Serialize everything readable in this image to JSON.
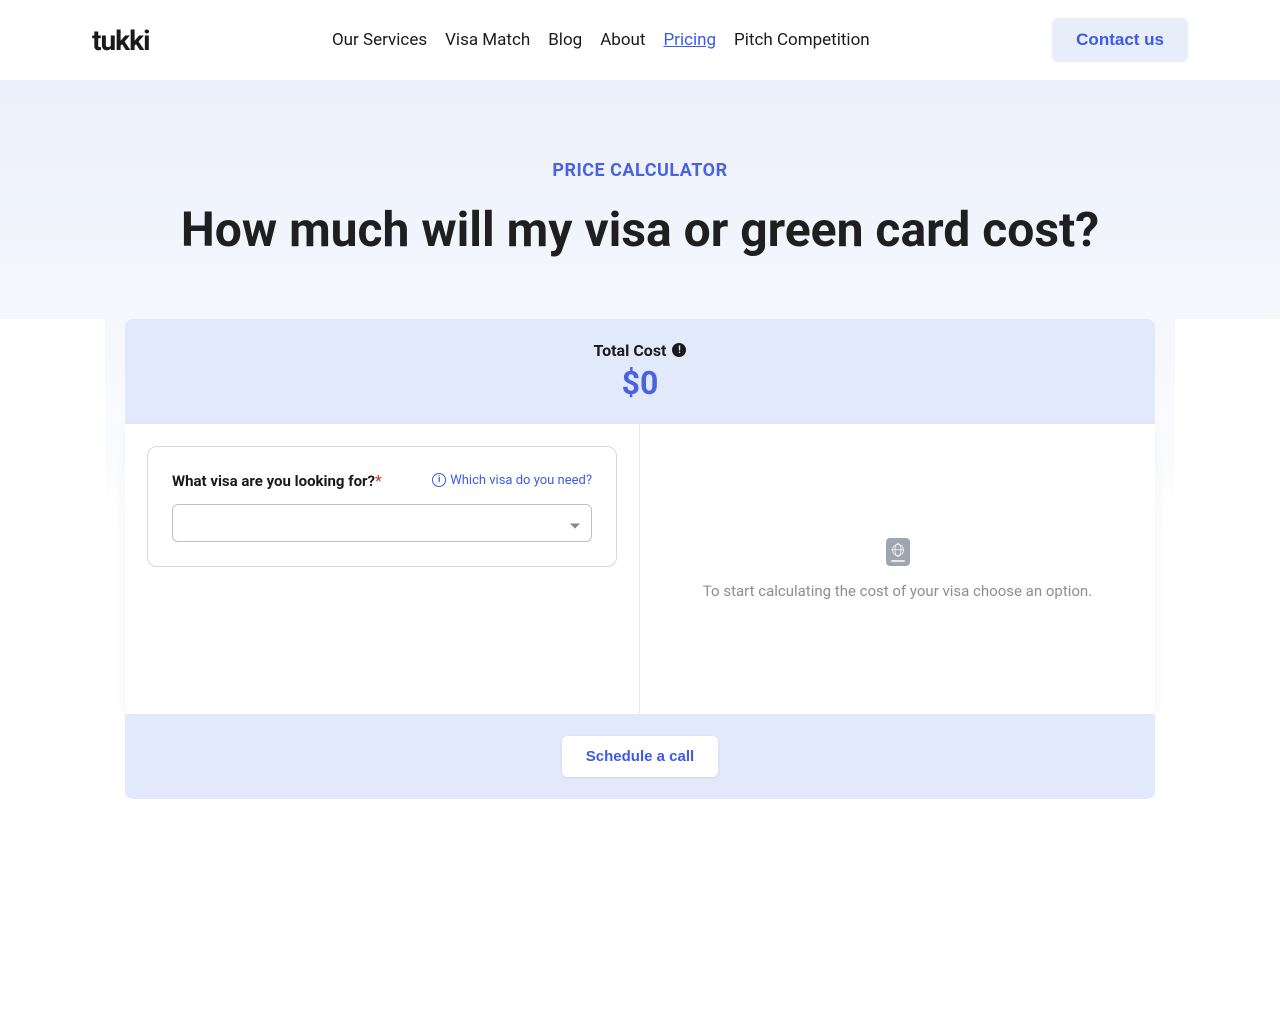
{
  "header": {
    "logo": "tukki",
    "nav": [
      {
        "label": "Our Services",
        "active": false
      },
      {
        "label": "Visa Match",
        "active": false
      },
      {
        "label": "Blog",
        "active": false
      },
      {
        "label": "About",
        "active": false
      },
      {
        "label": "Pricing",
        "active": true
      },
      {
        "label": "Pitch Competition",
        "active": false
      }
    ],
    "contact_button": "Contact us"
  },
  "hero": {
    "eyebrow": "PRICE CALCULATOR",
    "title": "How much will my visa or green card cost?"
  },
  "calculator": {
    "total_cost_label": "Total Cost",
    "total_cost_value": "$0",
    "question_label": "What visa are you looking for?",
    "help_link": "Which visa do you need?",
    "empty_state_text": "To start calculating the cost of your visa choose an option.",
    "schedule_button": "Schedule a call"
  }
}
